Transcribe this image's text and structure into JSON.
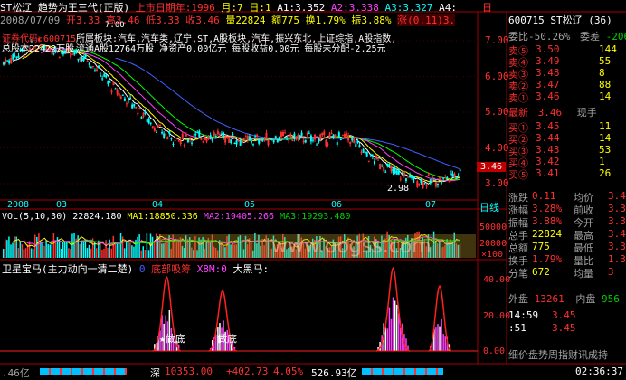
{
  "header": {
    "stock": "ST松辽",
    "indicator": "趋势为王三代(正版)",
    "listing": "上市日期年:1996",
    "month": "月:7",
    "day": "日:1",
    "a1": "A1:3.352",
    "a2": "A2:3.338",
    "a3": "A3:3.327",
    "a4": "A4:",
    "period_btn": "日"
  },
  "ohlc": {
    "date": "2008/07/09",
    "open": "开3.33",
    "high": "高3.46",
    "low": "低3.33",
    "close": "收3.46",
    "volume": "量22824",
    "amount": "额775",
    "turnover": "换1.79%",
    "amplitude": "振3.88%",
    "change": "涨(0.11)3."
  },
  "info": {
    "code": "证券代码:600715",
    "sectors": "所属板块:汽车,汽车类,辽宁,ST,A股板块,汽车,振兴东北,上证综指,A股指数,",
    "total_shares": "总股本22422万股",
    "float_shares": "流通A股12764万股",
    "net_assets": "净资产0.00亿元",
    "eps": "每股收益0.00元",
    "undistributed": "每股未分配-2.25元"
  },
  "price_axis": [
    "7.00",
    "6.00",
    "5.00",
    "4.00",
    "3.00"
  ],
  "price_marker": "3.46",
  "low_label": "2.98",
  "peak_mark": "7.00",
  "time_axis": [
    "2008",
    "03",
    "04",
    "05",
    "06",
    "07"
  ],
  "period_label": "日线",
  "vol": {
    "label": "VOL(5,10,30)",
    "value": "22824.180",
    "ma1": "MA1:18850.336",
    "ma2": "MA2:19405.266",
    "ma3": "MA3:19293.480",
    "axis": [
      "50000",
      "20000",
      "×100"
    ]
  },
  "sat": {
    "title": "卫星宝马(主力动向一清二楚)",
    "v0": "0",
    "bottom": "底部吸筹",
    "xbm": "X8M:0",
    "big_horse": "大黑马:",
    "axis": [
      "40.00",
      "20.00",
      "0.00"
    ],
    "label1": "★做底",
    "label2": "做底"
  },
  "watermark": "www.oogss.com",
  "status": {
    "left": ".46亿",
    "sz": "深",
    "sz_val": "10353.00",
    "sz_chg": "+402.73",
    "sz_pct": "4.05%",
    "sz_amt": "526.93亿",
    "time": "02:36:37"
  },
  "panel": {
    "code": "600715",
    "name": "ST松辽",
    "extra": "(36)",
    "ratio": "委比-50.26%",
    "diff": "委差",
    "diff_v": "-206",
    "sell": [
      {
        "label": "卖⑤",
        "price": "3.50",
        "vol": "144"
      },
      {
        "label": "卖④",
        "price": "3.49",
        "vol": "55"
      },
      {
        "label": "卖③",
        "price": "3.48",
        "vol": "8"
      },
      {
        "label": "卖②",
        "price": "3.47",
        "vol": "88"
      },
      {
        "label": "卖①",
        "price": "3.46",
        "vol": "14"
      }
    ],
    "latest_label": "最新",
    "latest": "3.46",
    "spot": "现手",
    "buy": [
      {
        "label": "买①",
        "price": "3.45",
        "vol": "11"
      },
      {
        "label": "买②",
        "price": "3.44",
        "vol": "14"
      },
      {
        "label": "买③",
        "price": "3.43",
        "vol": "53"
      },
      {
        "label": "买④",
        "price": "3.42",
        "vol": "1"
      },
      {
        "label": "买⑤",
        "price": "3.41",
        "vol": "26"
      }
    ],
    "stats": [
      {
        "l": "涨跌",
        "v": "0.11",
        "l2": "均价",
        "v2": "3.4"
      },
      {
        "l": "涨幅",
        "v": "3.28%",
        "l2": "前收",
        "v2": "3.3"
      },
      {
        "l": "振幅",
        "v": "3.88%",
        "l2": "今开",
        "v2": "3.3"
      },
      {
        "l": "总手",
        "v": "22824",
        "l2": "最高",
        "v2": "3.4"
      },
      {
        "l": "总额",
        "v": "775",
        "l2": "最低",
        "v2": "3.3"
      },
      {
        "l": "换手",
        "v": "1.79%",
        "l2": "量比",
        "v2": "1.3"
      },
      {
        "l": "分笔",
        "v": "672",
        "l2": "均量",
        "v2": "3"
      }
    ],
    "outer_l": "外盘",
    "outer_v": "13261",
    "inner_l": "内盘",
    "inner_v": "956",
    "ticks": [
      {
        "t": "14:59",
        "p": "3.45",
        "v": ""
      },
      {
        "t": ":51",
        "p": "3.45",
        "v": ""
      }
    ],
    "footer": "细价盘势周指财讯成持"
  },
  "colors": {
    "up": "#ff3030",
    "down": "#00ffff",
    "frame": "#a00000"
  }
}
